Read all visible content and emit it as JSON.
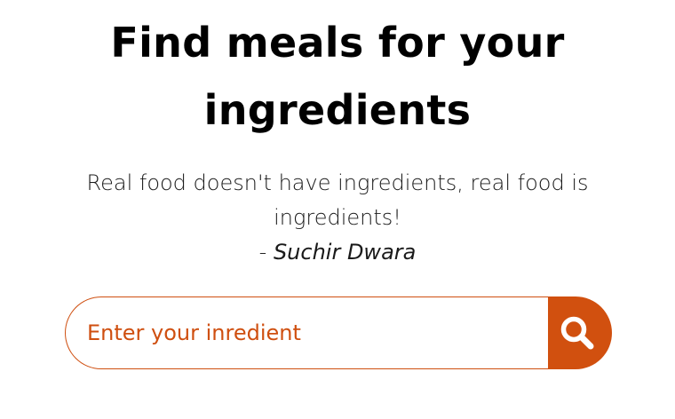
{
  "hero": {
    "title": "Find meals for your ingredients",
    "quote": "Real food doesn't have ingredients, real food is ingredients!",
    "author_prefix": "- ",
    "author_name": "Suchir Dwara"
  },
  "search": {
    "placeholder": "Enter your inredient",
    "value": "",
    "button_icon": "search-icon"
  },
  "colors": {
    "accent": "#d1500f",
    "background": "#ffffff",
    "text": "#000000"
  }
}
